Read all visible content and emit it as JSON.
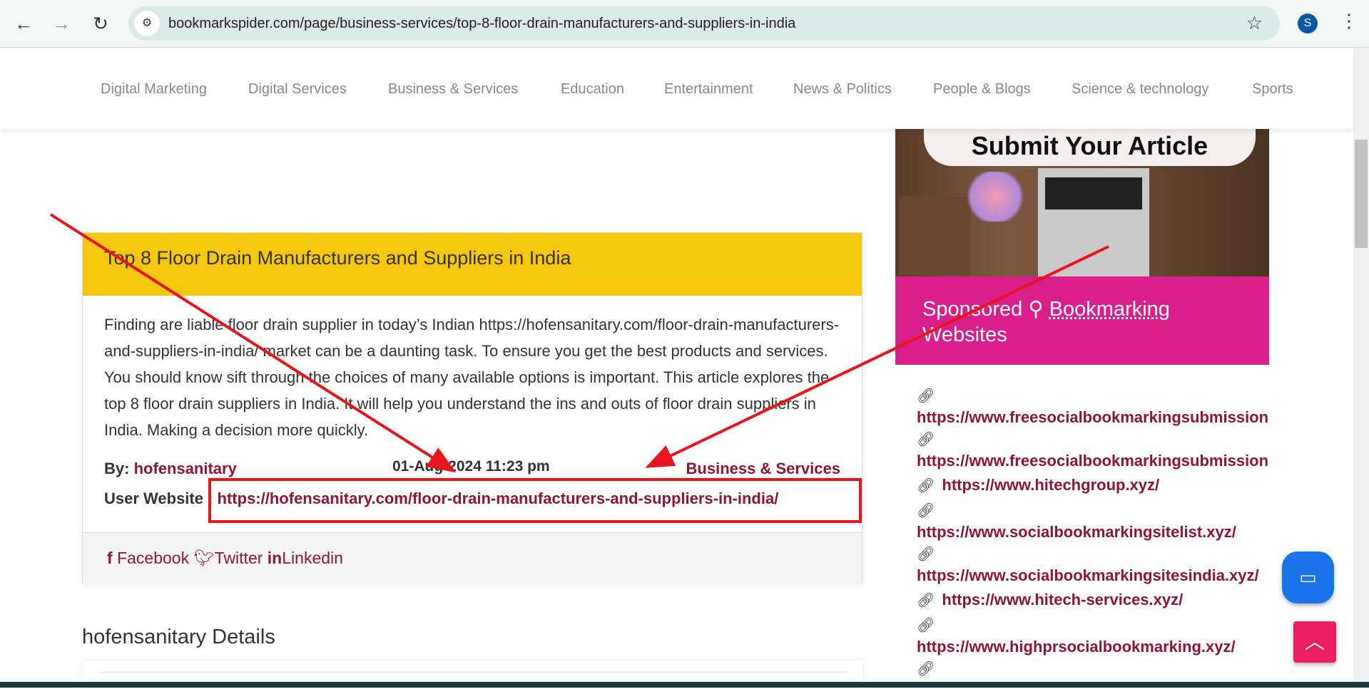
{
  "browser": {
    "url": "bookmarkspider.com/page/business-services/top-8-floor-drain-manufacturers-and-suppliers-in-india",
    "avatar": "S"
  },
  "nav": [
    "Digital Marketing",
    "Digital Services",
    "Business & Services",
    "Education",
    "Entertainment",
    "News & Politics",
    "People & Blogs",
    "Science & technology",
    "Sports"
  ],
  "article": {
    "title": "Top 8 Floor Drain Manufacturers and Suppliers in India",
    "body": "Finding are liable floor drain supplier in today’s Indian https://hofensanitary.com/floor-drain-manufacturers-and-suppliers-in-india/ market can be a daunting task. To ensure you get the best products and services. You should know sift through the choices of many available options is important. This article explores the top 8 floor drain suppliers in India. It will help you understand the ins and outs of floor drain suppliers in India. Making a decision more quickly.",
    "by_label": "By:",
    "author": "hofensanitary",
    "date": "01-Aug-2024 11:23 pm",
    "category": "Business & Services",
    "website_label": "User Website :",
    "website": "https://hofensanitary.com/floor-drain-manufacturers-and-suppliers-in-india/",
    "share": {
      "facebook": "Facebook",
      "twitter": "Twitter",
      "linkedin": "Linkedin"
    }
  },
  "details_heading": "hofensanitary Details",
  "sidebar": {
    "banner_text": "Submit Your Article",
    "sponsored": "Sponsored",
    "bookmarking": "Bookmarking",
    "websites": "Websites",
    "links": [
      "https://www.freesocialbookmarkingsubmissionsiteslist.xyz/",
      "https://www.freesocialbookmarkingsubmissionsites.xyz/",
      "https://www.hitechgroup.xyz/",
      "https://www.socialbookmarkingsitelist.xyz/",
      "https://www.socialbookmarkingsitesindia.xyz/",
      "https://www.hitech-services.xyz/",
      "https://www.highprsocialbookmarking.xyz/"
    ]
  },
  "colors": {
    "header": "#f6c70f",
    "sponsor": "#d81f8a",
    "link": "#8e1538",
    "annotation": "#e8141c"
  }
}
